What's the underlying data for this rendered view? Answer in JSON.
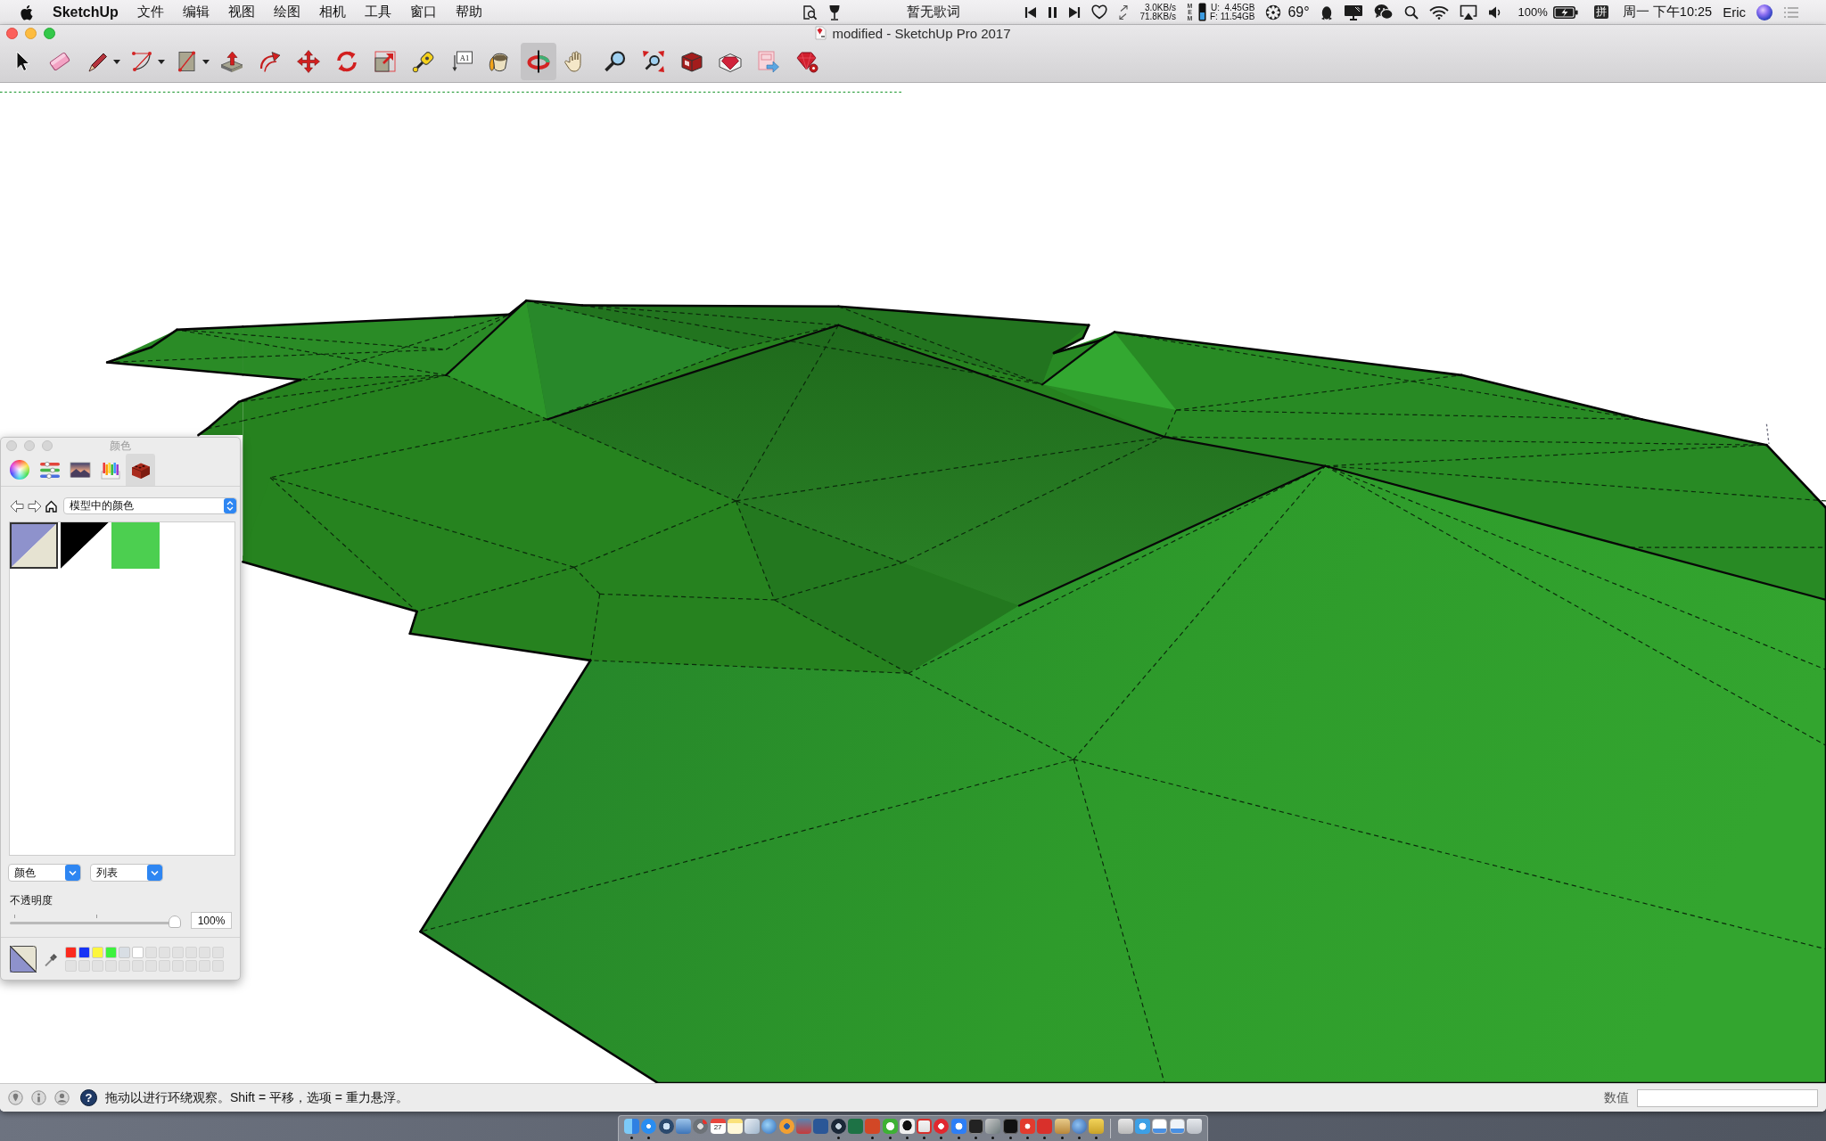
{
  "menu_bar": {
    "app_name": "SketchUp",
    "menus": [
      "文件",
      "编辑",
      "视图",
      "绘图",
      "相机",
      "工具",
      "窗口",
      "帮助"
    ],
    "lyrics": "暂无歌词",
    "upload_speed": "3.0KB/s",
    "download_speed": "71.8KB/s",
    "memory_label": "MEM",
    "memory_used": "U:  4.45GB",
    "memory_free": "F: 11.54GB",
    "temperature": "69°",
    "battery": "100%",
    "input_method": "拼",
    "clock": "周一 下午10:25",
    "user": "Eric"
  },
  "window": {
    "title": "modified - SketchUp Pro 2017"
  },
  "toolbar": {
    "tools": [
      {
        "kind": "select",
        "menu": false,
        "selected": false
      },
      {
        "kind": "eraser",
        "menu": false,
        "selected": false
      },
      {
        "kind": "pencil",
        "menu": true,
        "selected": false
      },
      {
        "kind": "arc",
        "menu": true,
        "selected": false
      },
      {
        "kind": "rectangle",
        "menu": true,
        "selected": false
      },
      {
        "kind": "push_pull",
        "menu": false,
        "selected": false
      },
      {
        "kind": "follow_me",
        "menu": false,
        "selected": false
      },
      {
        "kind": "move",
        "menu": false,
        "selected": false
      },
      {
        "kind": "rotate",
        "menu": false,
        "selected": false
      },
      {
        "kind": "scale",
        "menu": false,
        "selected": false
      },
      {
        "kind": "tape",
        "menu": false,
        "selected": false
      },
      {
        "kind": "text",
        "label": "A1",
        "menu": false,
        "selected": false
      },
      {
        "kind": "paint",
        "menu": false,
        "selected": false
      },
      {
        "kind": "orbit",
        "menu": false,
        "selected": true
      },
      {
        "kind": "pan",
        "menu": false,
        "selected": false
      },
      {
        "kind": "zoom",
        "menu": false,
        "selected": false
      },
      {
        "kind": "zoom_extents",
        "menu": false,
        "selected": false
      },
      {
        "kind": "warehouse",
        "menu": false,
        "selected": false
      },
      {
        "kind": "extensions",
        "menu": false,
        "selected": false
      },
      {
        "kind": "layout",
        "menu": false,
        "selected": false
      },
      {
        "kind": "ruby",
        "menu": false,
        "selected": false
      }
    ]
  },
  "color_panel": {
    "title": "颜色",
    "tabs": [
      {
        "kind": "wheel",
        "selected": false
      },
      {
        "kind": "sliders",
        "selected": false
      },
      {
        "kind": "image",
        "selected": false
      },
      {
        "kind": "pencils",
        "selected": false
      },
      {
        "kind": "bricks",
        "selected": true
      }
    ],
    "list_name": "模型中的颜色",
    "swatches": [
      {
        "colors": [
          {
            "color": "#8e92cc"
          },
          {
            "color": "#e6e3d2"
          }
        ],
        "selected": true
      },
      {
        "colors": [
          {
            "color": "#000000"
          },
          {
            "color": "#ffffff"
          }
        ],
        "selected": false
      },
      {
        "colors": [
          {
            "color": "#4ccf50"
          }
        ],
        "selected": false
      }
    ],
    "view_mode": "颜色",
    "layout_mode": "列表",
    "opacity": {
      "label": "不透明度",
      "level": 1,
      "reading": "100%"
    },
    "current_color": {
      "colors": [
        {
          "color": "#8e92cc"
        },
        {
          "color": "#e6e3d2"
        }
      ]
    },
    "favorites": [
      {
        "color": "#fb2a1e"
      },
      {
        "color": "#1633f5"
      },
      {
        "color": "#fcf63b"
      },
      {
        "color": "#3df23d"
      },
      {
        "color": "#d8dee4"
      },
      {
        "color": "#ffffff"
      }
    ]
  },
  "status_bar": {
    "help": "?",
    "hint": "拖动以进行环绕观察。Shift = 平移，选项 = 重力悬浮。",
    "value_label": "数值"
  },
  "dock": {
    "apps": [
      {
        "running": true
      },
      {
        "running": true
      },
      {
        "running": false
      },
      {
        "running": false
      },
      {
        "running": false
      },
      {
        "running": false,
        "label": "27"
      },
      {
        "running": false
      },
      {
        "running": false
      },
      {
        "running": false
      },
      {
        "running": false
      },
      {
        "running": false
      },
      {
        "running": false
      },
      {
        "running": true
      },
      {
        "running": false
      },
      {
        "running": true
      },
      {
        "running": true
      },
      {
        "running": true
      },
      {
        "running": true
      },
      {
        "running": true
      },
      {
        "running": true
      },
      {
        "running": true
      },
      {
        "running": true
      },
      {
        "running": true
      },
      {
        "running": true
      },
      {
        "running": true
      },
      {
        "running": true
      },
      {
        "running": true
      },
      {
        "running": true
      }
    ]
  }
}
